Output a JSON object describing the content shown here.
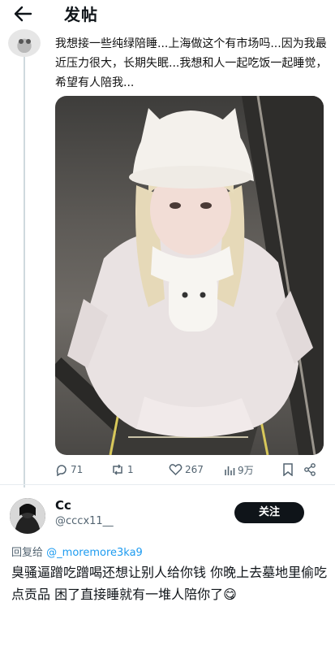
{
  "header": {
    "title": "发帖",
    "back_icon": "arrow-left-icon"
  },
  "post": {
    "text": "我想接一些纯绿陪睡...上海做这个有市场吗...因为我最近压力很大，长期失眠...我想和人一起吃饭一起睡觉，希望有人陪我...",
    "actions": {
      "comments": "71",
      "reposts": "1",
      "likes": "267",
      "views": "9万"
    }
  },
  "reply": {
    "name": "Cc",
    "handle": "@cccx11__",
    "follow_label": "关注",
    "reply_to_prefix": "回复给",
    "reply_to_mention": "@_moremore3ka9",
    "text": "臭骚逼蹭吃蹭喝还想让别人给你钱  你晚上去墓地里偷吃点贡品 困了直接睡就有一堆人陪你了😋"
  },
  "colors": {
    "accent": "#1d9bf0",
    "text": "#0f1419",
    "muted": "#536471",
    "button": "#0f1419"
  }
}
